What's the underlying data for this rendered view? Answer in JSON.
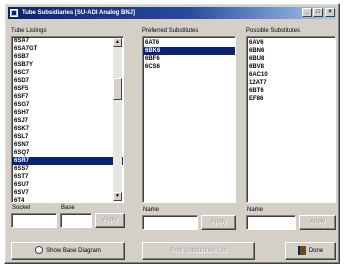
{
  "window": {
    "title": "Tube Subsidiaries  [SU-ADI  Analog  BNJ]",
    "minimize_label": "_",
    "maximize_label": "□",
    "close_label": "×"
  },
  "tube_listings": {
    "label": "Tube Listings",
    "items": [
      "6SA7",
      "6SA7GT",
      "6SB7",
      "6SB7Y",
      "6SC7",
      "6SD7",
      "6SF5",
      "6SF7",
      "6SG7",
      "6SH7",
      "6SJ7",
      "6SK7",
      "6SL7",
      "6SN7",
      "6SQ7",
      "6SR7",
      "6SS7",
      "6ST7",
      "6SU7",
      "6SV7",
      "6T4",
      "6T5",
      "6T7",
      "6T8"
    ],
    "selected_index": 15
  },
  "preferred_substitutes": {
    "label": "Preferred Substitutes",
    "items": [
      "6AT6",
      "6BK6",
      "6BF6",
      "6CS6"
    ],
    "selected_index": 1
  },
  "possible_substitutes": {
    "label": "Possible Substitutes",
    "items": [
      "6AV6",
      "6BN6",
      "6BU8",
      "6BV8",
      "6AC10",
      "12AT7",
      "6BT6",
      "EF86"
    ]
  },
  "left_inputs": {
    "label_a": "Socket",
    "label_b": "Base",
    "apply_label": "Apply"
  },
  "middle_inputs": {
    "label": "Name",
    "action_label": "Apply"
  },
  "right_inputs": {
    "label": "Name",
    "action_label": "Apply"
  },
  "bottom": {
    "show_base_btn": "Show Base Diagram",
    "center_btn": "Print Substitution List",
    "done_btn": "Done",
    "show_base_icon": "diagram-icon",
    "done_icon": "exit-door-icon"
  }
}
